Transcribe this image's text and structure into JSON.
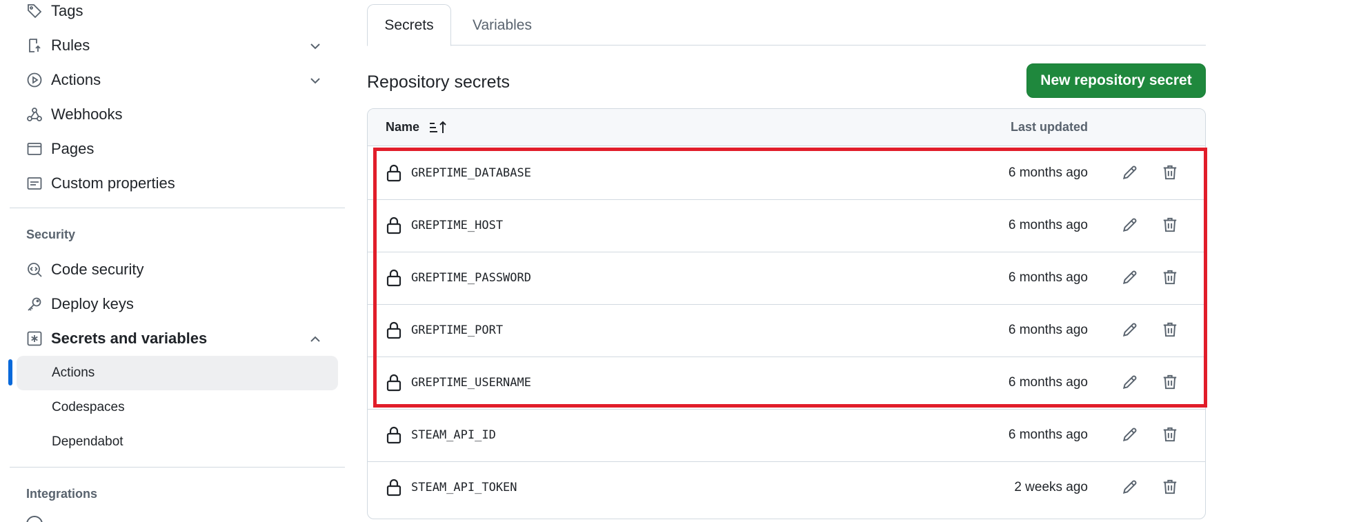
{
  "sidebar": {
    "items": [
      {
        "label": "Tags",
        "icon": "tag-icon"
      },
      {
        "label": "Rules",
        "icon": "rules-icon",
        "chevron": "chevron-down-icon"
      },
      {
        "label": "Actions",
        "icon": "play-icon",
        "chevron": "chevron-down-icon"
      },
      {
        "label": "Webhooks",
        "icon": "webhook-icon"
      },
      {
        "label": "Pages",
        "icon": "browser-icon"
      },
      {
        "label": "Custom properties",
        "icon": "note-icon"
      }
    ],
    "security_heading": "Security",
    "security_items": [
      {
        "label": "Code security",
        "icon": "codescan-icon"
      },
      {
        "label": "Deploy keys",
        "icon": "key-icon"
      },
      {
        "label": "Secrets and variables",
        "icon": "asterisk-icon",
        "chevron": "chevron-up-icon"
      }
    ],
    "sub_items": [
      {
        "label": "Actions",
        "active": true
      },
      {
        "label": "Codespaces",
        "active": false
      },
      {
        "label": "Dependabot",
        "active": false
      }
    ],
    "integrations_heading": "Integrations"
  },
  "tabs": [
    {
      "label": "Secrets",
      "active": true
    },
    {
      "label": "Variables",
      "active": false
    }
  ],
  "main": {
    "title": "Repository secrets",
    "new_button": "New repository secret",
    "accent_color": "#1f883d",
    "highlight_color": "#e11d2a"
  },
  "table": {
    "col_name": "Name",
    "col_updated": "Last updated",
    "rows": [
      {
        "name": "GREPTIME_DATABASE",
        "updated": "6 months ago"
      },
      {
        "name": "GREPTIME_HOST",
        "updated": "6 months ago"
      },
      {
        "name": "GREPTIME_PASSWORD",
        "updated": "6 months ago"
      },
      {
        "name": "GREPTIME_PORT",
        "updated": "6 months ago"
      },
      {
        "name": "GREPTIME_USERNAME",
        "updated": "6 months ago"
      },
      {
        "name": "STEAM_API_ID",
        "updated": "6 months ago"
      },
      {
        "name": "STEAM_API_TOKEN",
        "updated": "2 weeks ago"
      }
    ]
  }
}
